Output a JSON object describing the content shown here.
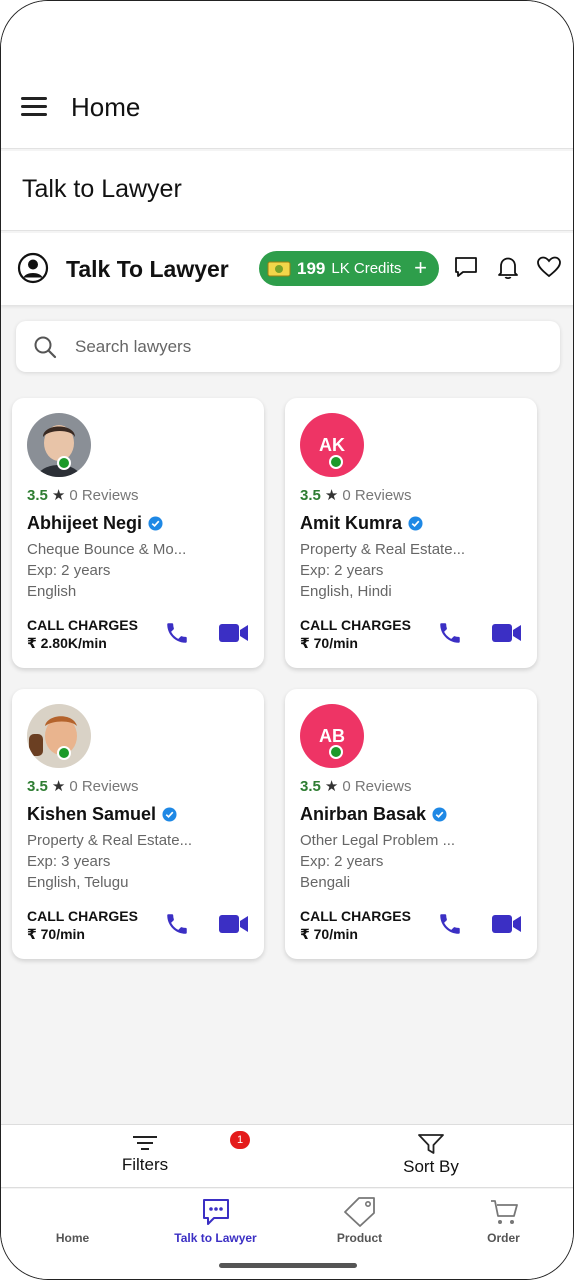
{
  "topbar": {
    "title": "Home"
  },
  "subheader": {
    "title": "Talk to Lawyer"
  },
  "appbar": {
    "title": "Talk To Lawyer",
    "credits_amount": "199",
    "credits_label": "LK Credits",
    "credits_plus": "+"
  },
  "search": {
    "placeholder": "Search lawyers"
  },
  "lawyers": [
    {
      "avatar": "photo",
      "rating": "3.5",
      "reviews": "0 Reviews",
      "name": "Abhijeet Negi",
      "specialty": "Cheque Bounce & Mo...",
      "experience": "Exp: 2 years",
      "languages": "English",
      "charges_label": "CALL CHARGES",
      "charges": "₹ 2.80K/min"
    },
    {
      "avatar": "initials",
      "initials": "AK",
      "rating": "3.5",
      "reviews": "0 Reviews",
      "name": "Amit Kumra",
      "specialty": "Property & Real Estate...",
      "experience": "Exp: 2 years",
      "languages": "English, Hindi",
      "charges_label": "CALL CHARGES",
      "charges": "₹ 70/min"
    },
    {
      "avatar": "photo",
      "rating": "3.5",
      "reviews": "0 Reviews",
      "name": "Kishen Samuel",
      "specialty": "Property & Real Estate...",
      "experience": "Exp: 3 years",
      "languages": "English, Telugu",
      "charges_label": "CALL CHARGES",
      "charges": "₹ 70/min"
    },
    {
      "avatar": "initials",
      "initials": "AB",
      "rating": "3.5",
      "reviews": "0 Reviews",
      "name": "Anirban Basak",
      "specialty": "Other Legal Problem ...",
      "experience": "Exp: 2 years",
      "languages": "Bengali",
      "charges_label": "CALL CHARGES",
      "charges": "₹ 70/min"
    }
  ],
  "filterbar": {
    "filters_label": "Filters",
    "filters_badge": "1",
    "sort_label": "Sort By"
  },
  "bottomnav": {
    "items": [
      {
        "label": "Home",
        "icon": "home-icon"
      },
      {
        "label": "Talk to Lawyer",
        "icon": "chat-icon",
        "active": true
      },
      {
        "label": "Product",
        "icon": "tag-icon"
      },
      {
        "label": "Order",
        "icon": "cart-icon"
      }
    ]
  },
  "colors": {
    "accent": "#3b2fc4",
    "credits_green": "#2e9e4b",
    "rating_green": "#2e7d32",
    "avatar_pink": "#ee3465",
    "online": "#1c9a2a",
    "verified_blue": "#1e88e5",
    "badge_red": "#e41b1b"
  }
}
